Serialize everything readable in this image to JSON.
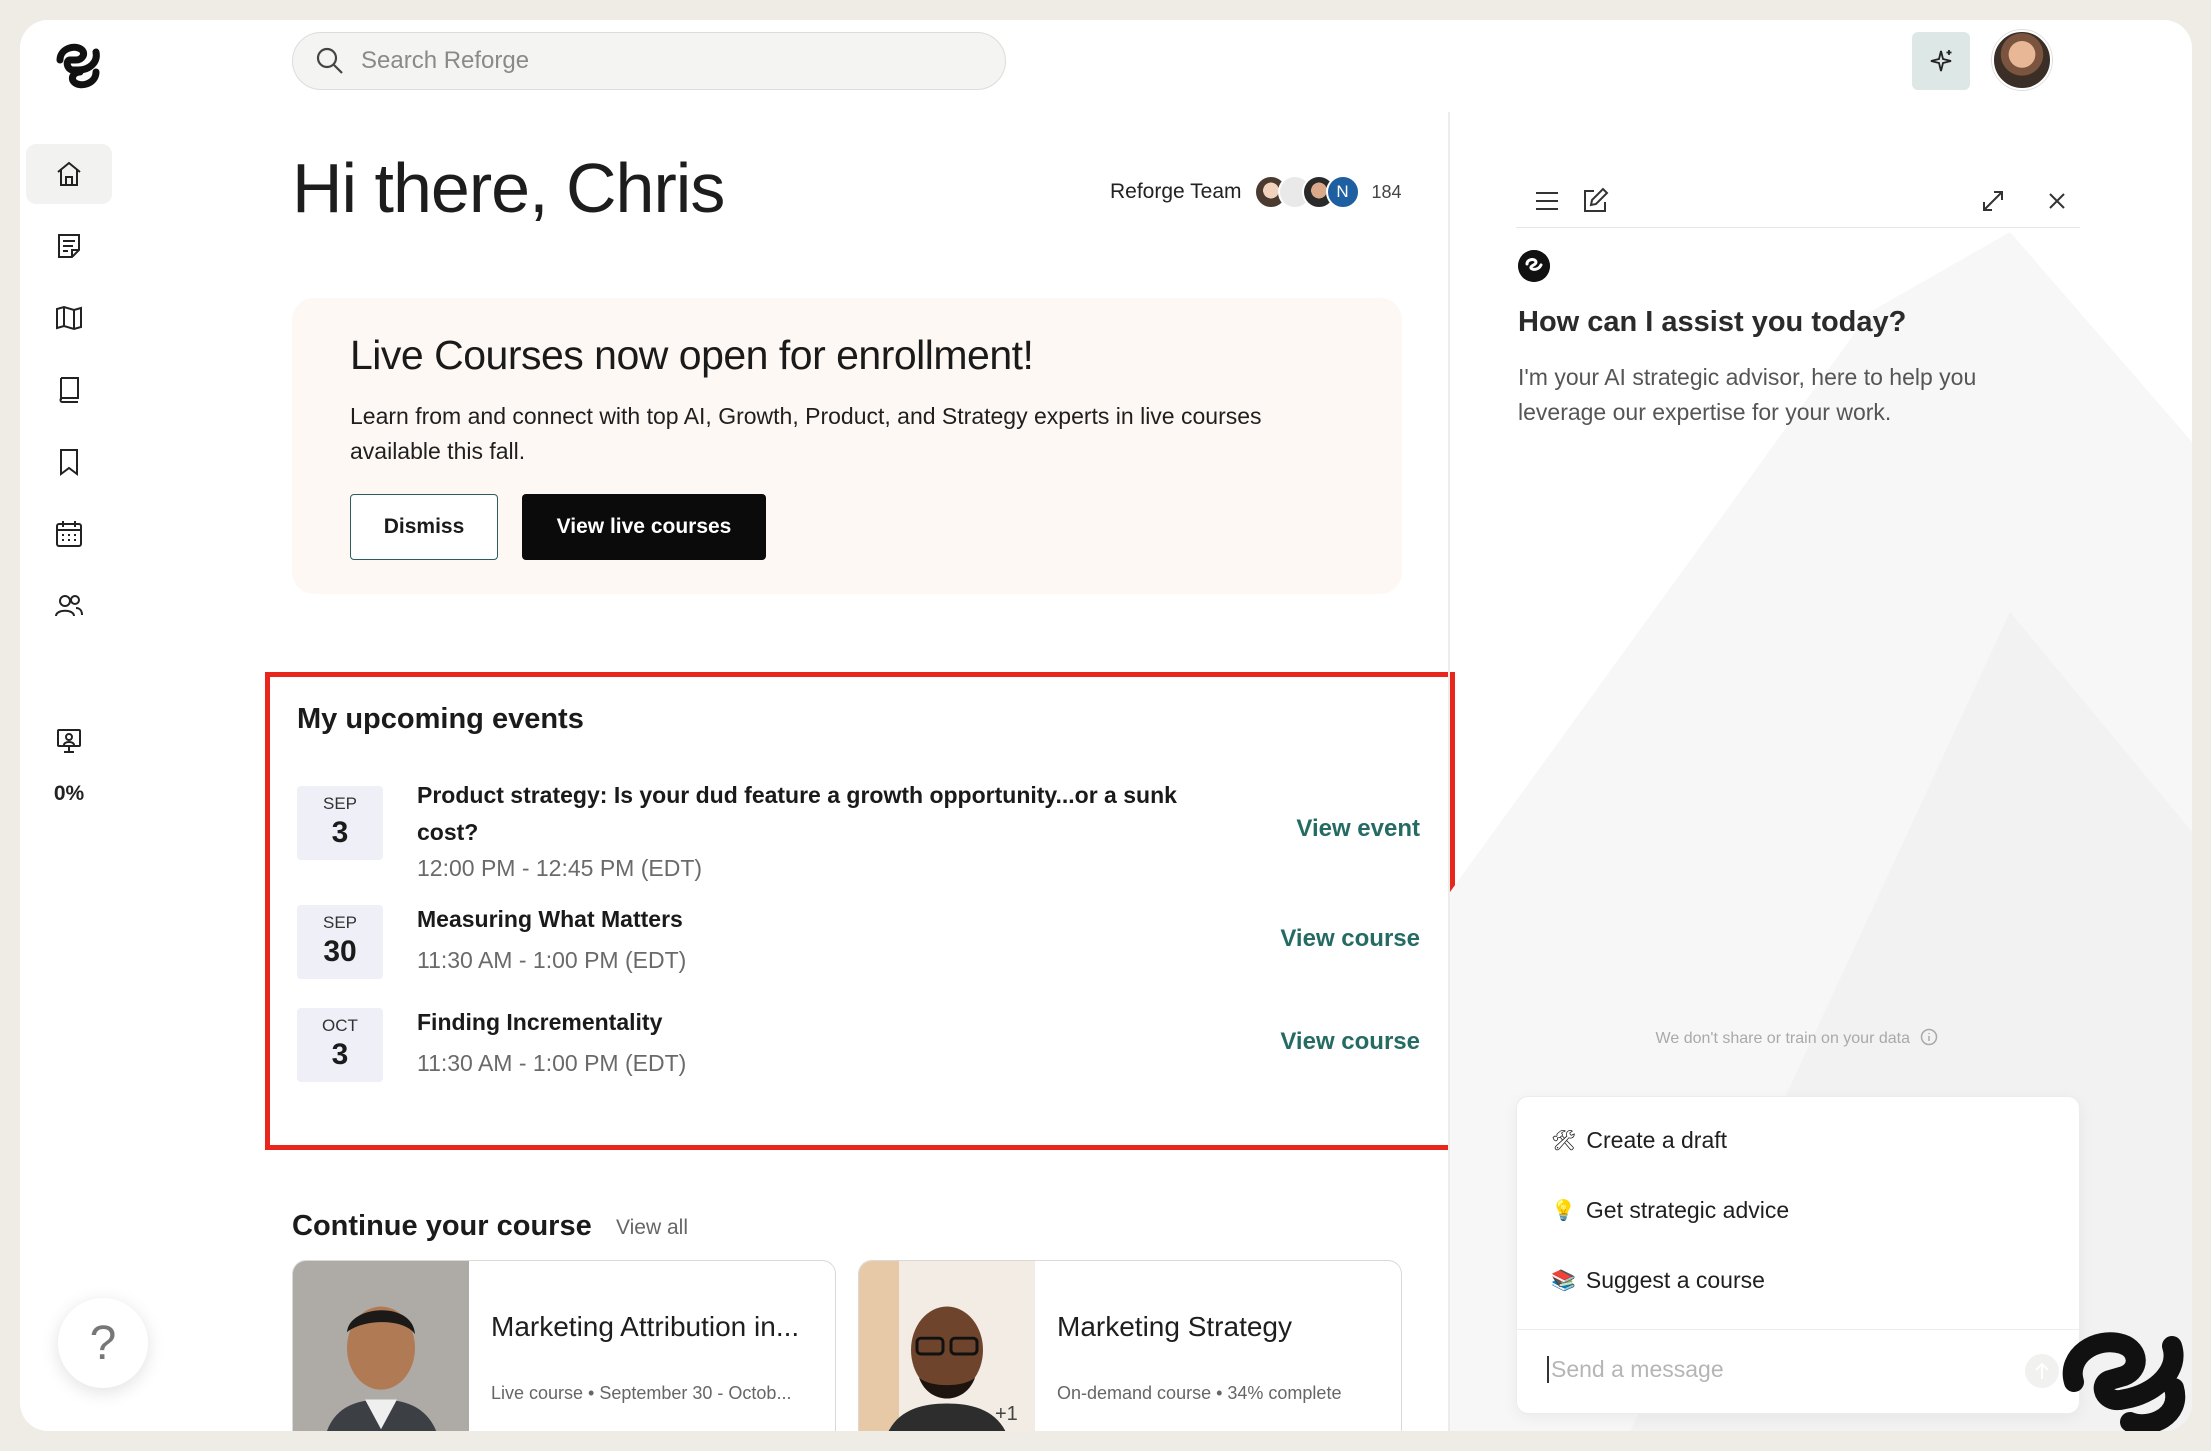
{
  "search": {
    "placeholder": "Search Reforge"
  },
  "sidebar": {
    "items": [
      {
        "name": "home",
        "icon": "home-icon"
      },
      {
        "name": "notes",
        "icon": "notes-icon"
      },
      {
        "name": "guides",
        "icon": "map-icon"
      },
      {
        "name": "library",
        "icon": "book-icon"
      },
      {
        "name": "saved",
        "icon": "bookmark-icon"
      },
      {
        "name": "events",
        "icon": "calendar-icon"
      },
      {
        "name": "community",
        "icon": "people-icon"
      }
    ],
    "progress": "0%",
    "help": "?"
  },
  "main": {
    "greeting": "Hi there, Chris",
    "team": {
      "label": "Reforge Team",
      "initial": "N",
      "count": "184"
    },
    "banner": {
      "title": "Live Courses now open for enrollment!",
      "text": "Learn from and connect with top AI, Growth, Product, and Strategy experts in live courses available this fall.",
      "dismiss": "Dismiss",
      "cta": "View live courses"
    },
    "events": {
      "title": "My upcoming events",
      "items": [
        {
          "month": "SEP",
          "day": "3",
          "title": "Product strategy: Is your dud feature a growth opportunity...or a sunk cost?",
          "time": "12:00 PM - 12:45 PM (EDT)",
          "action": "View event"
        },
        {
          "month": "SEP",
          "day": "30",
          "title": "Measuring What Matters",
          "time": "11:30 AM - 1:00 PM (EDT)",
          "action": "View course"
        },
        {
          "month": "OCT",
          "day": "3",
          "title": "Finding Incrementality",
          "time": "11:30 AM - 1:00 PM (EDT)",
          "action": "View course"
        }
      ]
    },
    "continue": {
      "title": "Continue your course",
      "view_all": "View all",
      "courses": [
        {
          "name": "Marketing Attribution in...",
          "meta": "Live course • September 30 - Octob..."
        },
        {
          "name": "Marketing Strategy",
          "meta": "On-demand course • 34% complete",
          "extra": "+1"
        }
      ]
    }
  },
  "assistant": {
    "heading": "How can I assist you today?",
    "intro": "I'm your AI strategic advisor, here to help you leverage our expertise for your work.",
    "privacy": "We don't share or train on your data",
    "prompts": [
      {
        "emoji": "🛠",
        "label": "Create a draft"
      },
      {
        "emoji": "💡",
        "label": "Get strategic advice"
      },
      {
        "emoji": "📚",
        "label": "Suggest a course"
      }
    ],
    "input_placeholder": "Send a message"
  },
  "colors": {
    "accent_teal": "#256b64",
    "highlight_border": "#e8261c",
    "banner_bg": "#fdf8f3",
    "date_chip_bg": "#eeeff7"
  }
}
